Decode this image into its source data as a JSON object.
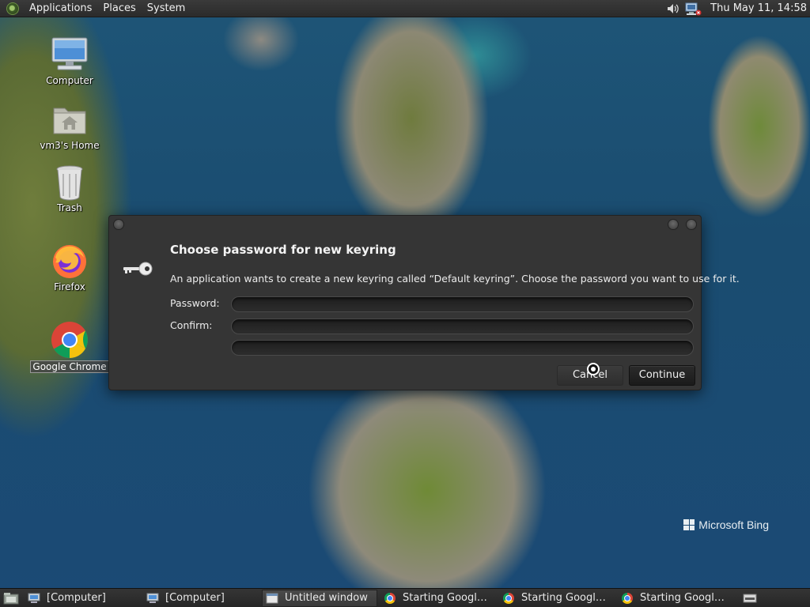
{
  "top_panel": {
    "menus": [
      "Applications",
      "Places",
      "System"
    ],
    "clock": "Thu May 11, 14:58"
  },
  "desktop": {
    "icons": [
      {
        "label": "Computer"
      },
      {
        "label": "vm3's Home"
      },
      {
        "label": "Trash"
      },
      {
        "label": "Firefox"
      },
      {
        "label": "Google Chrome"
      }
    ],
    "wallpaper_watermark": "Microsoft Bing"
  },
  "dialog": {
    "title": "Choose password for new keyring",
    "description": "An application wants to create a new keyring called “Default keyring”. Choose the password you want to use for it.",
    "password_label": "Password:",
    "confirm_label": "Confirm:",
    "password_value": "",
    "confirm_value": "",
    "cancel_label": "Cancel",
    "continue_label": "Continue"
  },
  "taskbar": {
    "tasks": [
      {
        "label": "[Computer]",
        "icon": "computer-icon",
        "active": false
      },
      {
        "label": "[Computer]",
        "icon": "computer-icon",
        "active": false
      },
      {
        "label": "Untitled window",
        "icon": "window-icon",
        "active": true
      },
      {
        "label": "Starting Google ...",
        "icon": "chrome-icon",
        "active": false
      },
      {
        "label": "Starting Google ...",
        "icon": "chrome-icon",
        "active": false
      },
      {
        "label": "Starting Google ...",
        "icon": "chrome-icon",
        "active": false
      }
    ]
  },
  "colors": {
    "panel": "#2b2b2b",
    "dialog_bg": "#353535",
    "sea": "#1d4a6e"
  }
}
